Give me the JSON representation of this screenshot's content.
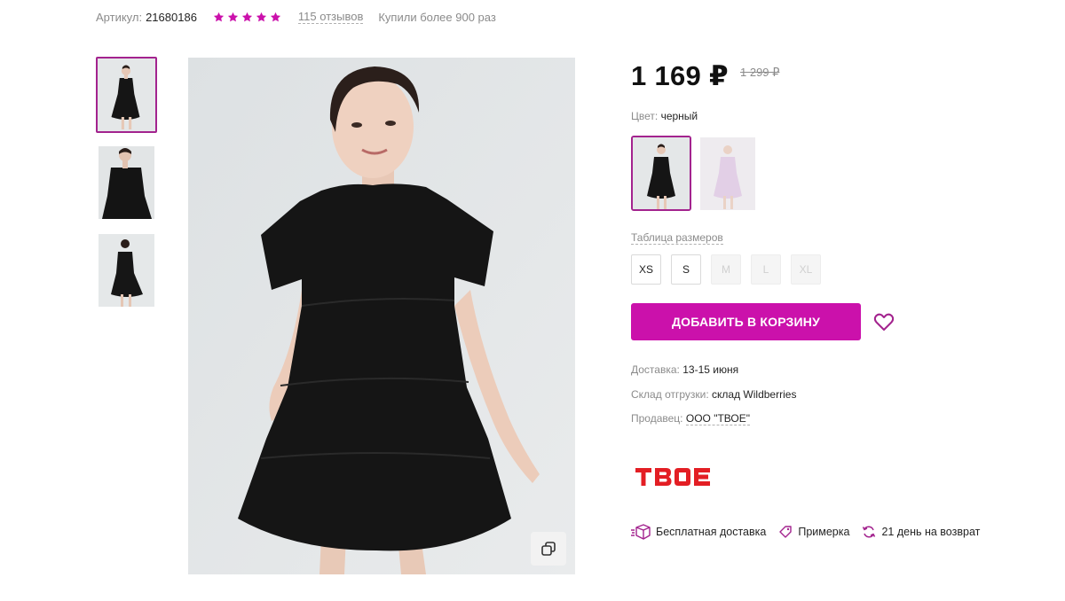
{
  "meta": {
    "sku_label": "Артикул:",
    "sku_value": "21680186",
    "rating": 5,
    "reviews": "115 отзывов",
    "bought": "Купили более 900 раз"
  },
  "product": {
    "price": "1 169 ₽",
    "old_price": "1 299 ₽",
    "color_label": "Цвет:",
    "color_value": "черный",
    "size_table": "Таблица размеров",
    "sizes": [
      {
        "label": "XS",
        "available": true
      },
      {
        "label": "S",
        "available": true
      },
      {
        "label": "M",
        "available": false
      },
      {
        "label": "L",
        "available": false
      },
      {
        "label": "XL",
        "available": false
      }
    ],
    "add_to_cart": "ДОБАВИТЬ В КОРЗИНУ",
    "delivery_label": "Доставка:",
    "delivery_value": "13-15 июня",
    "warehouse_label": "Склад отгрузки:",
    "warehouse_value": "склад Wildberries",
    "seller_label": "Продавец:",
    "seller_value": "ООО \"ТВОЕ\"",
    "brand_logo": "ТВОЕ"
  },
  "features": [
    {
      "icon": "box-icon",
      "label": "Бесплатная доставка"
    },
    {
      "icon": "tag-icon",
      "label": "Примерка"
    },
    {
      "icon": "return-icon",
      "label": "21 день на возврат"
    }
  ],
  "colors": {
    "accent": "#cb11ab",
    "accent_border": "#a3238e",
    "brand_red": "#e31e24",
    "star": "#cb11ab"
  }
}
